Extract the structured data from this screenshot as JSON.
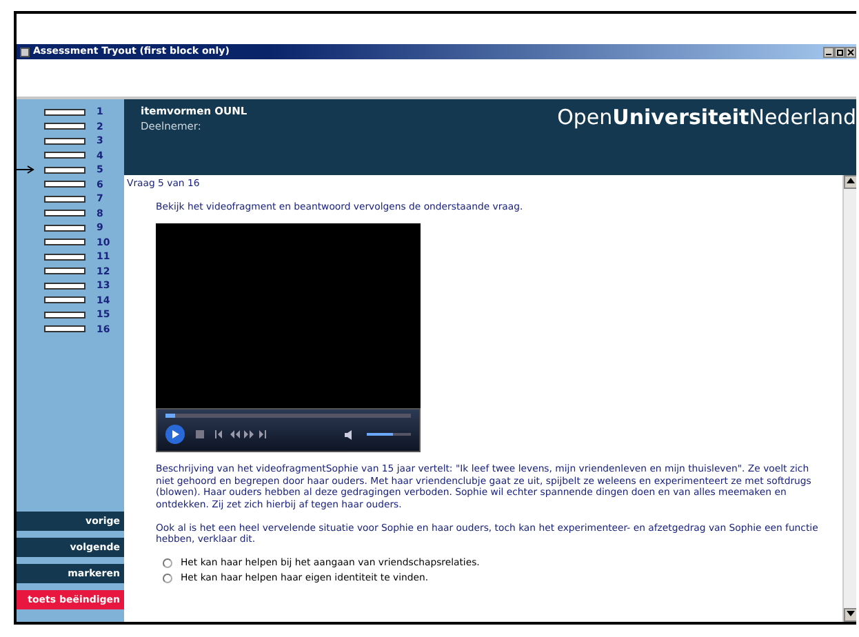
{
  "window": {
    "title": "Assessment Tryout (first block only)"
  },
  "header": {
    "title": "itemvormen OUNL",
    "participant_label": "Deelnemer:",
    "logo": "Open**Universiteit**Nederland"
  },
  "sidebar": {
    "items": [
      {
        "number": "1",
        "selected": false
      },
      {
        "number": "2",
        "selected": false
      },
      {
        "number": "3",
        "selected": false
      },
      {
        "number": "4",
        "selected": false
      },
      {
        "number": "5",
        "selected": true
      },
      {
        "number": "6",
        "selected": false
      },
      {
        "number": "7",
        "selected": false
      },
      {
        "number": "8",
        "selected": false
      },
      {
        "number": "9",
        "selected": false
      },
      {
        "number": "10",
        "selected": false
      },
      {
        "number": "11",
        "selected": false
      },
      {
        "number": "12",
        "selected": false
      },
      {
        "number": "13",
        "selected": false
      },
      {
        "number": "14",
        "selected": false
      },
      {
        "number": "15",
        "selected": false
      },
      {
        "number": "16",
        "selected": false
      }
    ],
    "buttons": [
      {
        "label": "vorige",
        "kind": "nav"
      },
      {
        "label": "volgende",
        "kind": "nav"
      },
      {
        "label": "markeren",
        "kind": "nav"
      },
      {
        "label": "toets beëindigen",
        "kind": "end"
      }
    ]
  },
  "question": {
    "counter": "Vraag 5 van 16",
    "instruction": "Bekijk het videofragment en beantwoord vervolgens de onderstaande vraag.",
    "video": {
      "level": 0.04
    },
    "description": "Beschrijving van het videofragmentSophie van 15 jaar vertelt: \"Ik leef twee levens, mijn vriendenleven en mijn thuisleven\". Ze voelt zich niet gehoord en begrepen door haar ouders. Met haar vriendenclubje gaat ze uit, spijbelt ze weleens en experimenteert ze met softdrugs (blowen). Haar ouders hebben al deze gedragingen verboden. Sophie wil echter spannende dingen doen en van alles meemaken en ontdekken. Zij zet zich hierbij af tegen haar ouders.",
    "prompt": "Ook al is het een heel vervelende situatie voor Sophie en haar ouders, toch kan het experimenteer- en afzetgedrag van Sophie een functie hebben, verklaar dit.",
    "options": [
      {
        "label": "Het kan haar helpen bij het aangaan van vriendschapsrelaties.",
        "selected": false
      },
      {
        "label": "Het kan haar helpen haar eigen identiteit te vinden.",
        "selected": false
      }
    ]
  }
}
